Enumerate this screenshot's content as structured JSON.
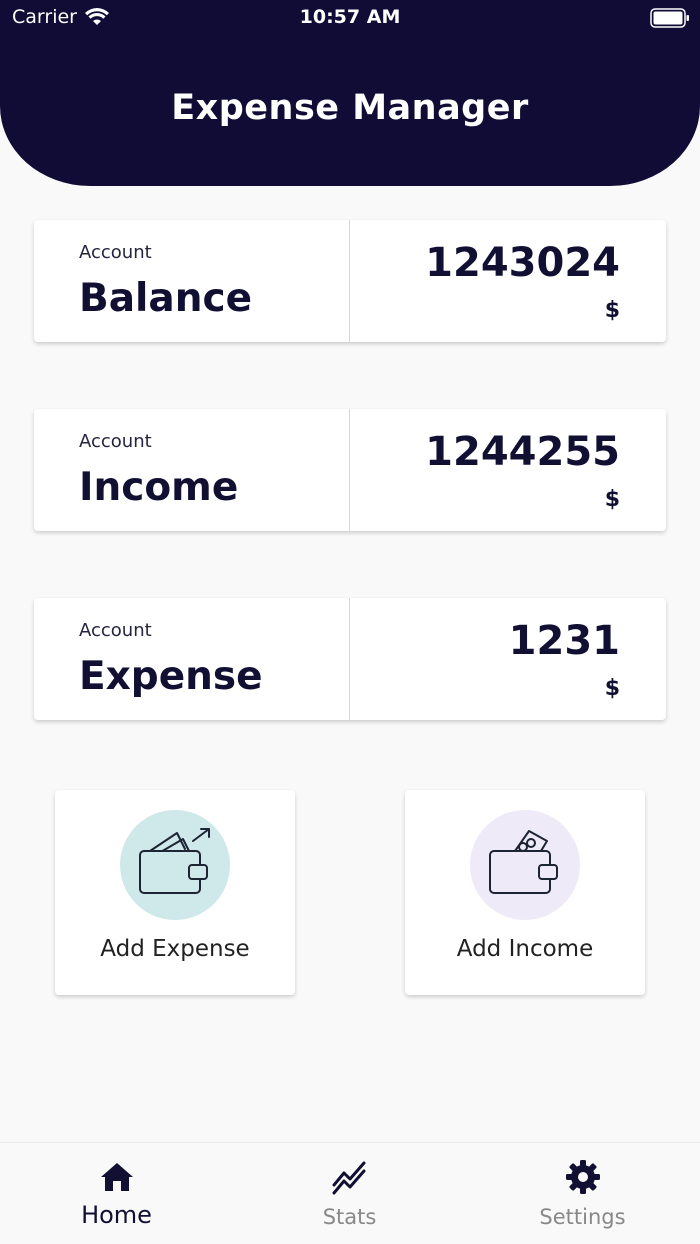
{
  "status_bar": {
    "carrier": "Carrier",
    "time": "10:57 AM"
  },
  "header": {
    "title": "Expense Manager"
  },
  "cards": [
    {
      "subtitle": "Account",
      "title": "Balance",
      "value": "1243024",
      "currency": "$"
    },
    {
      "subtitle": "Account",
      "title": "Income",
      "value": "1244255",
      "currency": "$"
    },
    {
      "subtitle": "Account",
      "title": "Expense",
      "value": "1231",
      "currency": "$"
    }
  ],
  "actions": {
    "add_expense": {
      "label": "Add Expense",
      "icon": "wallet-out-icon",
      "color": "#cfe8ea"
    },
    "add_income": {
      "label": "Add Income",
      "icon": "wallet-in-icon",
      "color": "#eeeaf8"
    }
  },
  "nav": {
    "home": {
      "label": "Home",
      "icon": "home-icon"
    },
    "stats": {
      "label": "Stats",
      "icon": "stats-icon"
    },
    "settings": {
      "label": "Settings",
      "icon": "gear-icon"
    }
  },
  "colors": {
    "header": "#110c36",
    "text": "#111033",
    "inactive": "#888888"
  }
}
